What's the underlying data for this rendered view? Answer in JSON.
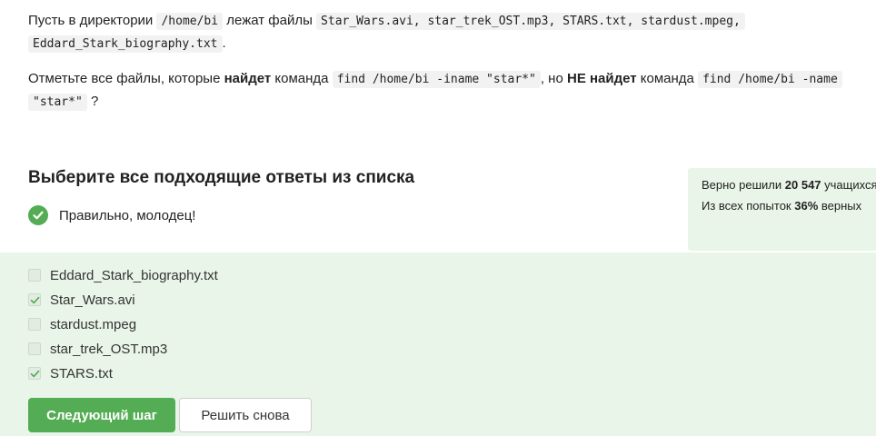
{
  "question": {
    "p1_text_1": "Пусть в директории ",
    "p1_code_dir": "/home/bi",
    "p1_text_2": " лежат файлы ",
    "p1_code_files_a": "Star_Wars.avi, star_trek_OST.mp3, STARS.txt, stardust.mpeg,",
    "p1_code_files_b": "Eddard_Stark_biography.txt",
    "p1_text_3": ".",
    "p2_text_1": "Отметьте все файлы, которые ",
    "p2_bold_1": "найдет",
    "p2_text_2": " команда ",
    "p2_code_1": "find /home/bi -iname \"star*\"",
    "p2_text_3": ", но ",
    "p2_bold_2": "НЕ найдет",
    "p2_text_4": " команда ",
    "p2_code_2a": "find /home/bi -name",
    "p2_code_2b": "\"star*\"",
    "p2_text_5": "?"
  },
  "task": {
    "heading": "Выберите все подходящие ответы из списка",
    "feedback": "Правильно, молодец!"
  },
  "stats": {
    "solved_prefix": "Верно решили ",
    "solved_count": "20 547",
    "solved_suffix": " учащихся",
    "attempts_prefix": "Из всех попыток ",
    "attempts_percent": "36%",
    "attempts_suffix": " верных"
  },
  "options": [
    {
      "label": "Eddard_Stark_biography.txt",
      "checked": false
    },
    {
      "label": "Star_Wars.avi",
      "checked": true
    },
    {
      "label": "stardust.mpeg",
      "checked": false
    },
    {
      "label": "star_trek_OST.mp3",
      "checked": false
    },
    {
      "label": "STARS.txt",
      "checked": true
    }
  ],
  "buttons": {
    "next": "Следующий шаг",
    "retry": "Решить снова"
  },
  "colors": {
    "accent_green": "#54ad54",
    "answers_background": "#e9f5e9",
    "code_background": "#f2f2f2"
  }
}
